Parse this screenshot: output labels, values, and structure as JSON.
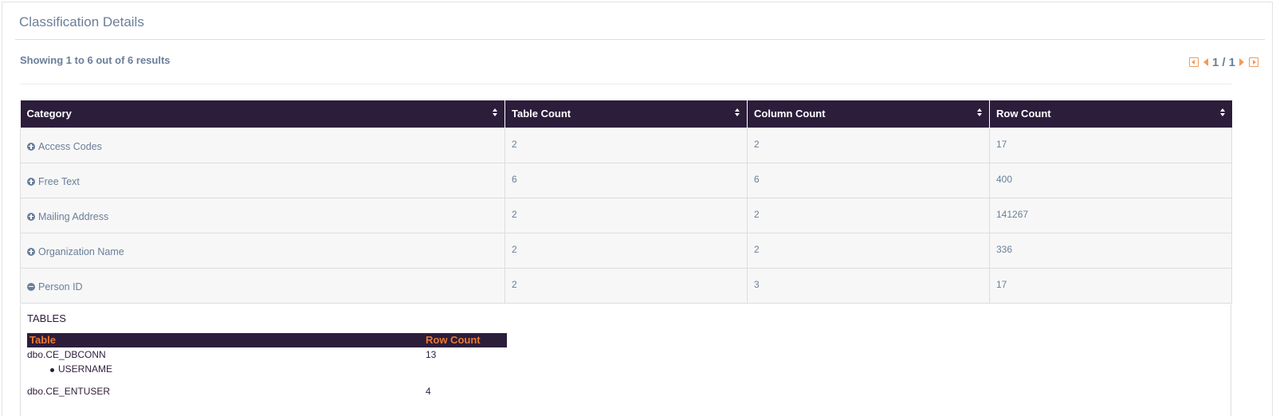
{
  "panel": {
    "title": "Classification Details"
  },
  "summary": {
    "showing": "Showing 1 to 6 out of 6 results"
  },
  "pager": {
    "text": "1 / 1"
  },
  "table": {
    "headers": [
      "Category",
      "Table Count",
      "Column Count",
      "Row Count"
    ],
    "rows": [
      {
        "category": "Access Codes",
        "table_count": "2",
        "column_count": "2",
        "row_count": "17",
        "expanded": false
      },
      {
        "category": "Free Text",
        "table_count": "6",
        "column_count": "6",
        "row_count": "400",
        "expanded": false
      },
      {
        "category": "Mailing Address",
        "table_count": "2",
        "column_count": "2",
        "row_count": "141267",
        "expanded": false
      },
      {
        "category": "Organization Name",
        "table_count": "2",
        "column_count": "2",
        "row_count": "336",
        "expanded": false
      },
      {
        "category": "Person ID",
        "table_count": "2",
        "column_count": "3",
        "row_count": "17",
        "expanded": true
      }
    ]
  },
  "detail": {
    "title": "TABLES",
    "headers": {
      "table": "Table",
      "row_count": "Row Count"
    },
    "rows": [
      {
        "table": "dbo.CE_DBCONN",
        "row_count": "13",
        "columns": [
          "USERNAME"
        ]
      },
      {
        "table": "dbo.CE_ENTUSER",
        "row_count": "4",
        "columns": []
      }
    ]
  },
  "colors": {
    "header_bg": "#2c1d3b",
    "accent_orange": "#f0782d",
    "text_muted": "#6a7f99"
  }
}
